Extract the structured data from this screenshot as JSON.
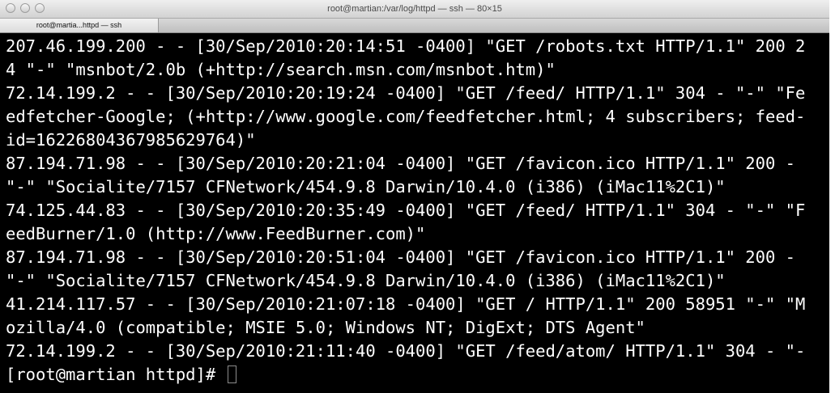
{
  "window": {
    "title": "root@martian:/var/log/httpd — ssh — 80×15"
  },
  "tabs": [
    {
      "label": "root@martia...httpd — ssh"
    }
  ],
  "terminal": {
    "lines": [
      "207.46.199.200 - - [30/Sep/2010:20:14:51 -0400] \"GET /robots.txt HTTP/1.1\" 200 2",
      "4 \"-\" \"msnbot/2.0b (+http://search.msn.com/msnbot.htm)\"",
      "72.14.199.2 - - [30/Sep/2010:20:19:24 -0400] \"GET /feed/ HTTP/1.1\" 304 - \"-\" \"Fe",
      "edfetcher-Google; (+http://www.google.com/feedfetcher.html; 4 subscribers; feed-",
      "id=16226804367985629764)\"",
      "87.194.71.98 - - [30/Sep/2010:20:21:04 -0400] \"GET /favicon.ico HTTP/1.1\" 200 -",
      "\"-\" \"Socialite/7157 CFNetwork/454.9.8 Darwin/10.4.0 (i386) (iMac11%2C1)\"",
      "74.125.44.83 - - [30/Sep/2010:20:35:49 -0400] \"GET /feed/ HTTP/1.1\" 304 - \"-\" \"F",
      "eedBurner/1.0 (http://www.FeedBurner.com)\"",
      "87.194.71.98 - - [30/Sep/2010:20:51:04 -0400] \"GET /favicon.ico HTTP/1.1\" 200 -",
      "\"-\" \"Socialite/7157 CFNetwork/454.9.8 Darwin/10.4.0 (i386) (iMac11%2C1)\"",
      "41.214.117.57 - - [30/Sep/2010:21:07:18 -0400] \"GET / HTTP/1.1\" 200 58951 \"-\" \"M",
      "ozilla/4.0 (compatible; MSIE 5.0; Windows NT; DigExt; DTS Agent\"",
      "72.14.199.2 - - [30/Sep/2010:21:11:40 -0400] \"GET /feed/atom/ HTTP/1.1\" 304 - \"-"
    ],
    "prompt": "[root@martian httpd]# "
  }
}
